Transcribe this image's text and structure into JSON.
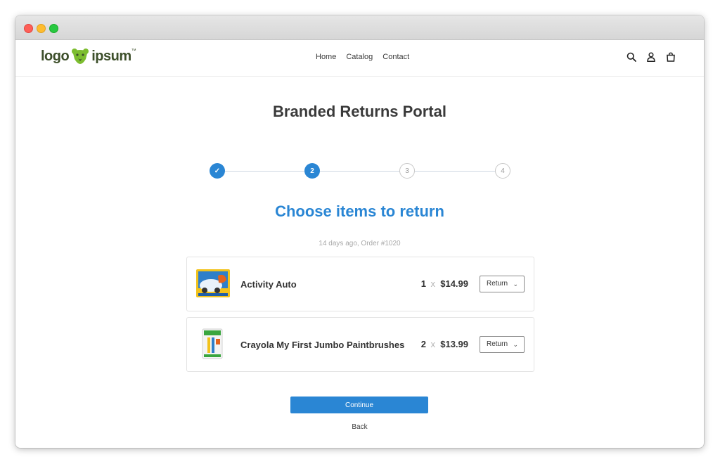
{
  "brand": {
    "logo_left": "logo",
    "logo_right": "ipsum",
    "logo_tm": "™",
    "logo_color": "#3d4f2a",
    "mark_color": "#7cbd2f"
  },
  "nav": {
    "items": [
      {
        "label": "Home"
      },
      {
        "label": "Catalog"
      },
      {
        "label": "Contact"
      }
    ]
  },
  "header_icons": [
    "search-icon",
    "account-icon",
    "cart-icon"
  ],
  "page_title": "Branded Returns Portal",
  "stepper": {
    "current_step": 2,
    "steps": [
      {
        "label": "✓",
        "state": "done"
      },
      {
        "label": "2",
        "state": "active"
      },
      {
        "label": "3",
        "state": "pending"
      },
      {
        "label": "4",
        "state": "pending"
      }
    ]
  },
  "section_title": "Choose items to return",
  "order_meta": "14 days ago, Order #1020",
  "items": [
    {
      "name": "Activity Auto",
      "qty": "1",
      "times": "x",
      "price": "$14.99",
      "action": "Return"
    },
    {
      "name": "Crayola My First Jumbo Paintbrushes",
      "qty": "2",
      "times": "x",
      "price": "$13.99",
      "action": "Return"
    }
  ],
  "actions": {
    "continue_label": "Continue",
    "back_label": "Back"
  },
  "colors": {
    "accent": "#2a86d4",
    "text": "#3a3a3a",
    "muted": "#a8a8a8"
  }
}
